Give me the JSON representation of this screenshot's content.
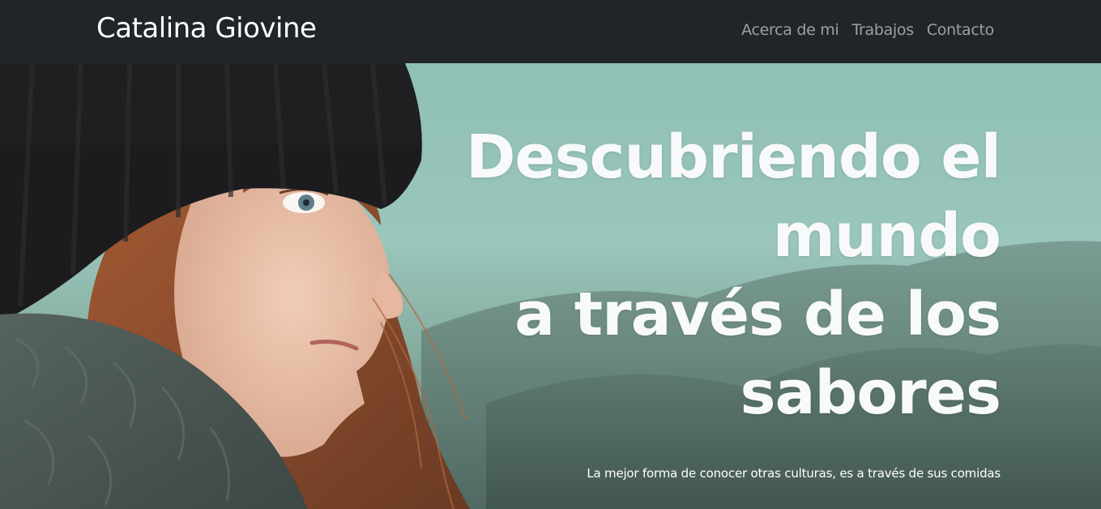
{
  "navbar": {
    "brand": "Catalina Giovine",
    "links": [
      "Acerca de mi",
      "Trabajos",
      "Contacto"
    ]
  },
  "hero": {
    "title_lines": [
      "Descubriendo el",
      "mundo",
      "a través de los",
      "sabores"
    ],
    "subtitle": "La mejor forma de conocer otras culturas, es a través de sus comidas",
    "image": "woman-in-black-beanie-portrait"
  },
  "colors": {
    "navbar_bg": "#212529",
    "brand_text": "#ffffff",
    "nav_link_text": "#9aa0a6",
    "hero_title_text": "#f8f9fa",
    "hero_bg_teal": "#9ac6bc"
  }
}
